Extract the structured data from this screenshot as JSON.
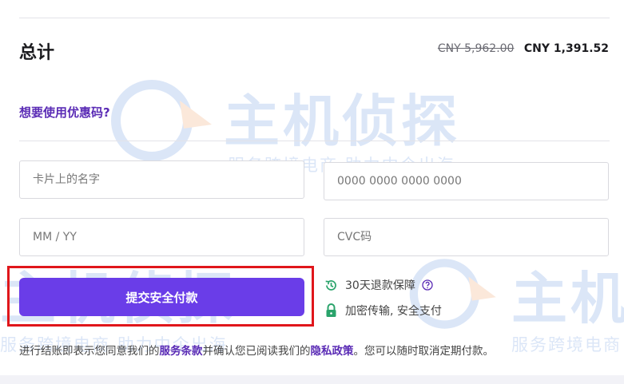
{
  "summary": {
    "total_label": "总计",
    "original_price": "CNY 5,962.00",
    "final_price": "CNY 1,391.52"
  },
  "coupon": {
    "link_text": "想要使用优惠码?"
  },
  "form": {
    "name_placeholder": "卡片上的名字",
    "card_placeholder": "0000 0000 0000 0000",
    "expiry_placeholder": "MM / YY",
    "cvc_placeholder": "CVC码"
  },
  "submit": {
    "label": "提交安全付款",
    "accent_color": "#6a3de8",
    "highlight_color": "#e0161b"
  },
  "assurances": {
    "refund": {
      "text": "30天退款保障",
      "icon": "refund-clock-icon",
      "icon_color": "#2aa36b"
    },
    "secure": {
      "text": "加密传输, 安全支付",
      "icon": "lock-icon",
      "icon_color": "#2aa36b"
    }
  },
  "terms": {
    "prefix": "进行结账即表示您同意我们的",
    "terms_link": "服务条款",
    "middle": "并确认您已阅读我们的",
    "privacy_link": "隐私政策",
    "suffix": "。您可以随时取消定期付款。",
    "link_color": "#5a2bb5"
  },
  "watermark": {
    "title": "主机侦探",
    "subtitle": "服务跨境电商 助力中企出海"
  }
}
